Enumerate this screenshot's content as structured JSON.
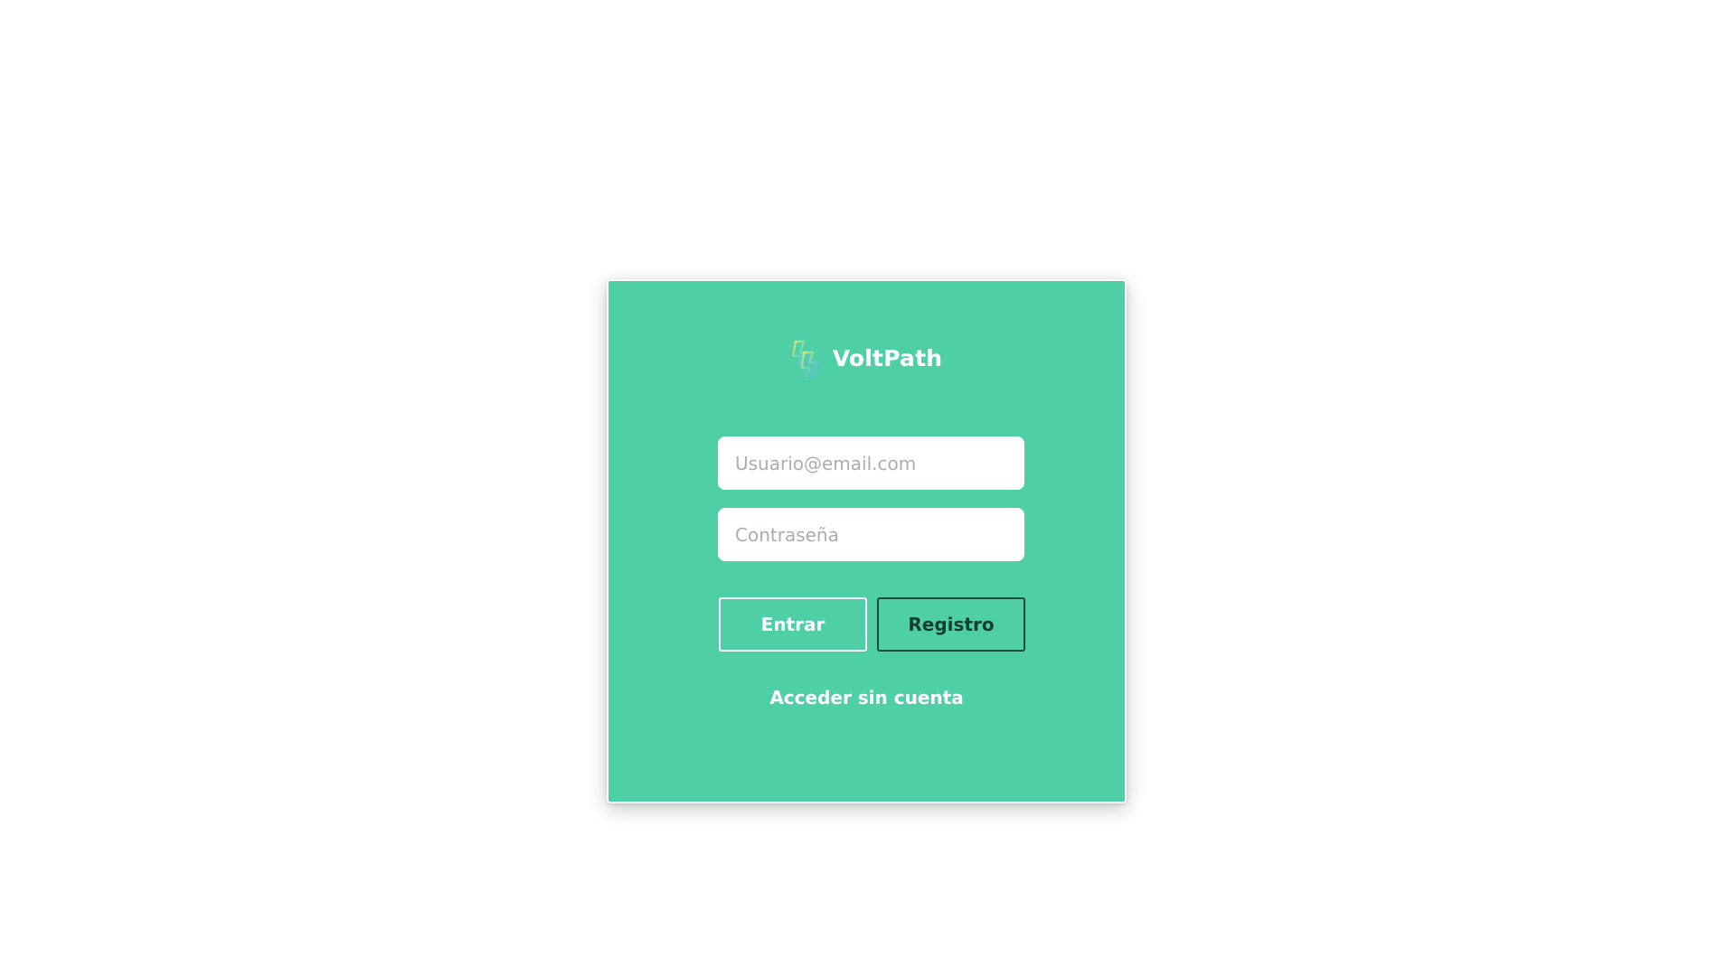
{
  "app": {
    "name": "VoltPath",
    "logo_icon": "lightning-bolt-icon"
  },
  "login_form": {
    "email_placeholder": "Usuario@email.com",
    "email_value": "",
    "password_placeholder": "Contraseña",
    "password_value": "",
    "login_label": "Entrar",
    "register_label": "Registro",
    "guest_label": "Acceder sin cuenta"
  },
  "colors": {
    "card_background": "#4ecfa6",
    "pattern_green": "#86e0c0",
    "pattern_blue": "#a6d8f3",
    "register_border": "#1b4a3a"
  }
}
